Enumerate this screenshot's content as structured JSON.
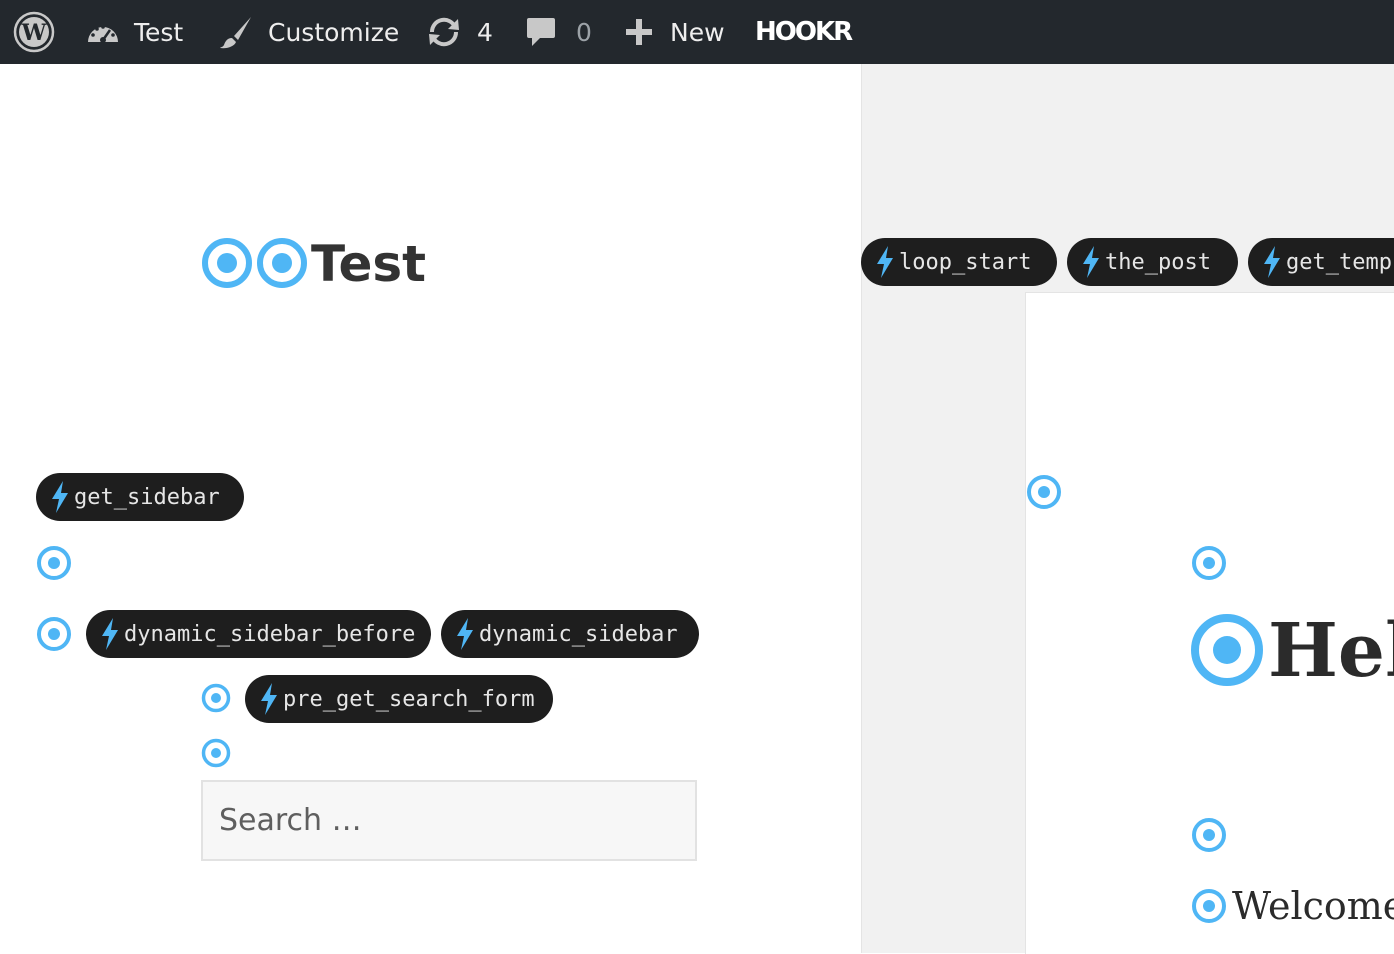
{
  "admin_bar": {
    "site_name": "Test",
    "customize_label": "Customize",
    "updates_count": "4",
    "comments_count": "0",
    "new_label": "New",
    "hookr_label": "HOOKR"
  },
  "site": {
    "title": "Test"
  },
  "hooks": {
    "get_sidebar": "get_sidebar",
    "dynamic_sidebar_before": "dynamic_sidebar_before",
    "dynamic_sidebar": "dynamic_sidebar",
    "pre_get_search_form": "pre_get_search_form",
    "loop_start": "loop_start",
    "the_post": "the_post",
    "get_template_part": "get_temp"
  },
  "search": {
    "placeholder": "Search …"
  },
  "article": {
    "heading": "Hel",
    "text": "Welcome"
  },
  "colors": {
    "admin_bar_bg": "#23282d",
    "pill_bg": "#1e1e1e",
    "accent_blue": "#4fb6f5"
  }
}
